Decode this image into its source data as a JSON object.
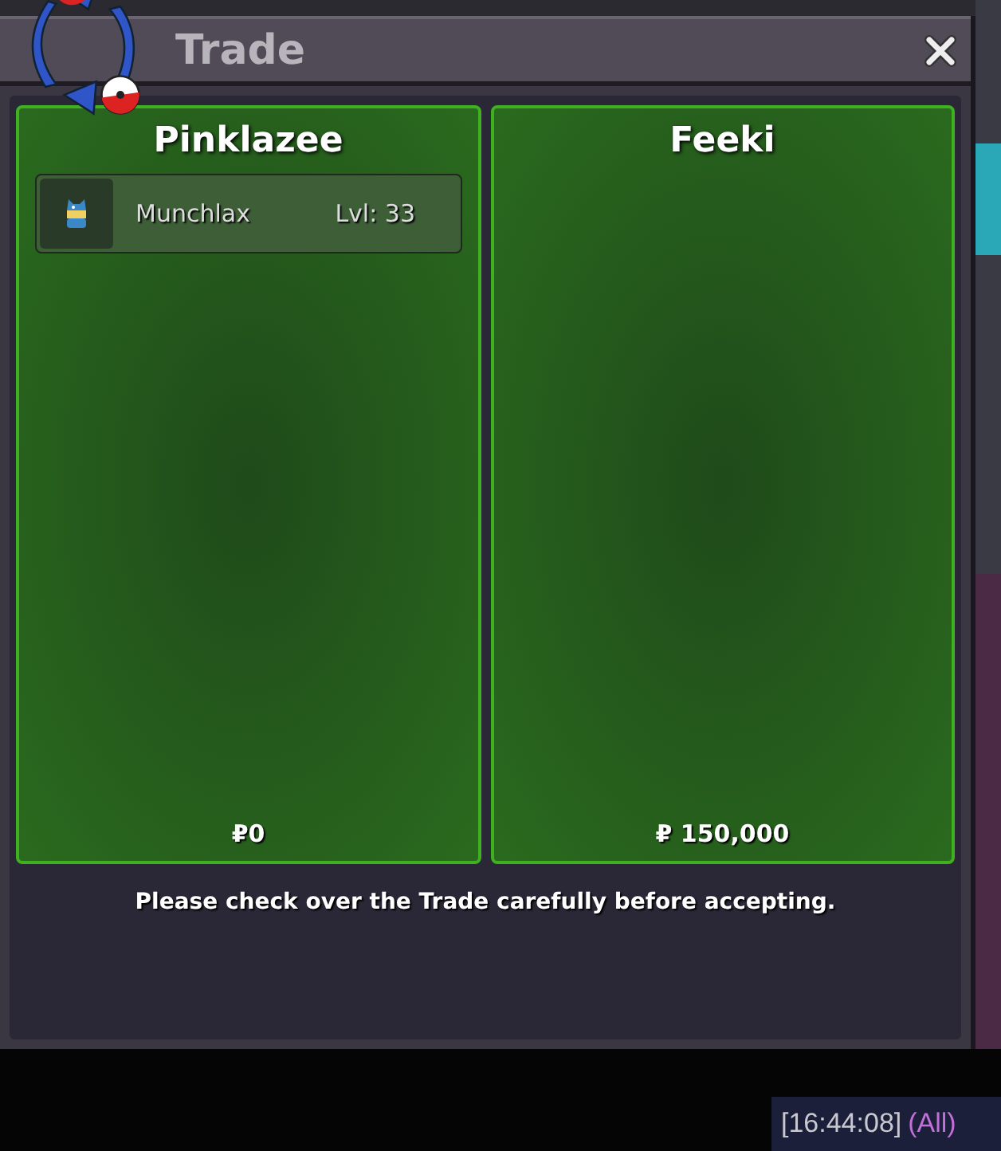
{
  "window": {
    "title": "Trade"
  },
  "panels": [
    {
      "trainer": "Pinklazee",
      "offers": [
        {
          "name": "Munchlax",
          "level": "Lvl: 33"
        }
      ],
      "money": "₽0"
    },
    {
      "trainer": "Feeki",
      "money": "₽ 150,000"
    }
  ],
  "notice": "Please check over the Trade carefully before accepting.",
  "chat": {
    "timestamp": "[16:44:08]",
    "channel": "(All)"
  }
}
